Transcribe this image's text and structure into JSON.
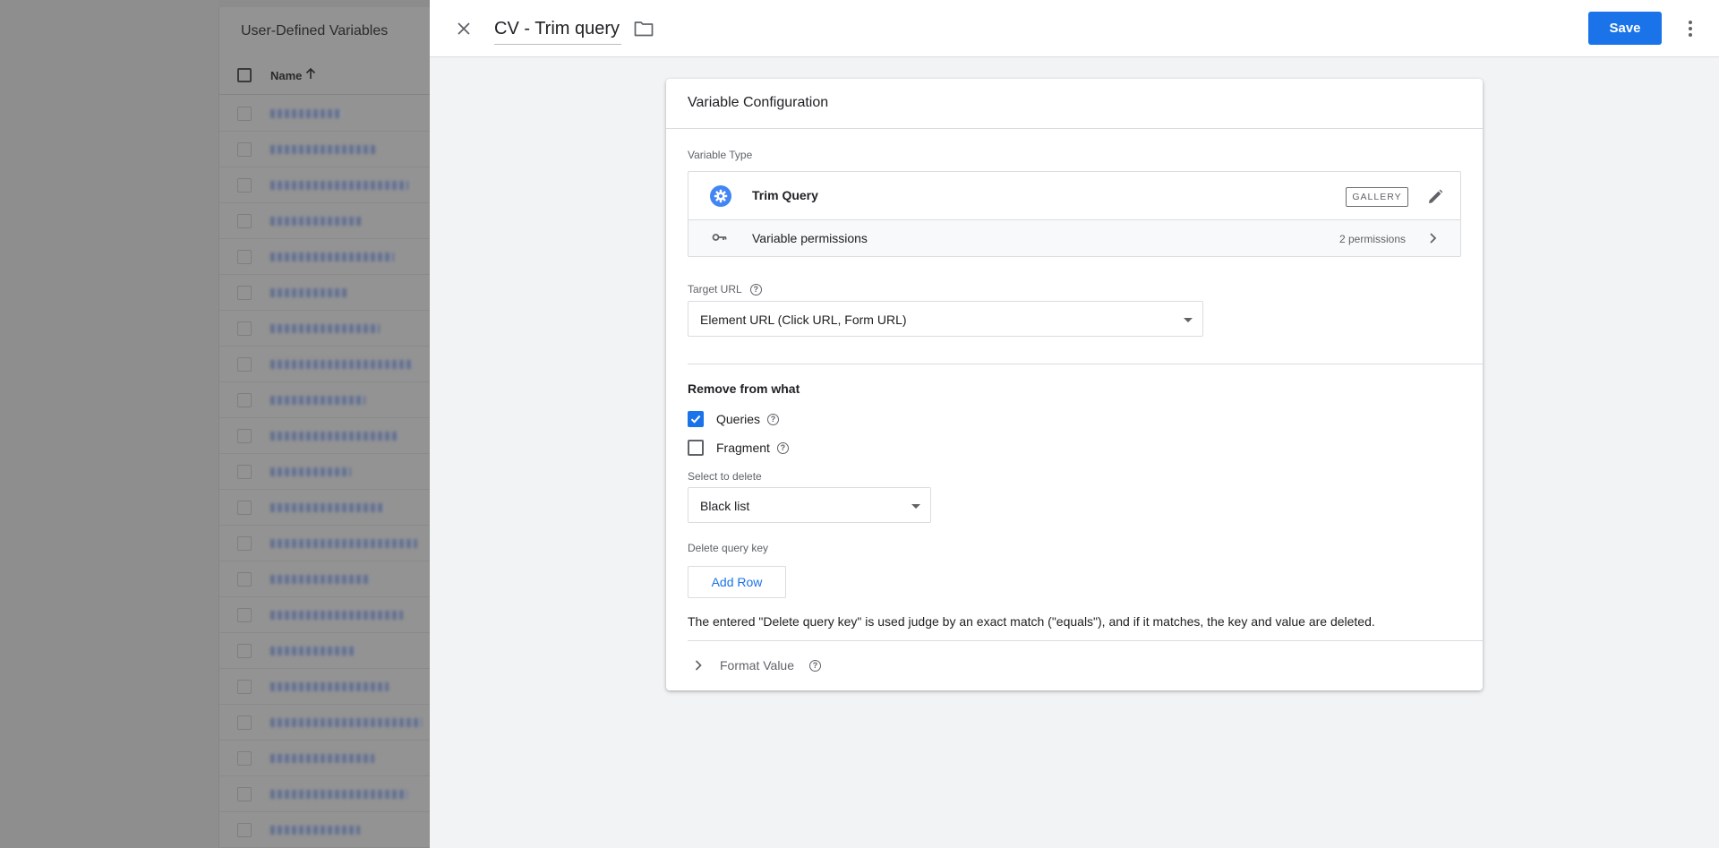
{
  "background": {
    "panel_title": "User-Defined Variables",
    "column_name": "Name",
    "row_count": 21
  },
  "editor": {
    "title": "CV - Trim query",
    "save_label": "Save",
    "card_title": "Variable Configuration",
    "variable_type_label": "Variable Type",
    "type_name": "Trim Query",
    "gallery_badge": "GALLERY",
    "permissions_label": "Variable permissions",
    "permissions_count": "2 permissions",
    "target_url_label": "Target URL",
    "target_url_value": "Element URL (Click URL, Form URL)",
    "remove_section_title": "Remove from what",
    "queries_label": "Queries",
    "queries_checked": true,
    "fragment_label": "Fragment",
    "fragment_checked": false,
    "select_delete_label": "Select to delete",
    "select_delete_value": "Black list",
    "delete_key_label": "Delete query key",
    "add_row_label": "Add Row",
    "note": "The entered \"Delete query key\" is used judge by an exact match (\"equals\"), and if it matches, the key and value are deleted.",
    "format_value_label": "Format Value",
    "colors": {
      "primary": "#1a73e8",
      "icon_blue": "#4285f4",
      "page_bg": "#f1f3f4"
    }
  }
}
